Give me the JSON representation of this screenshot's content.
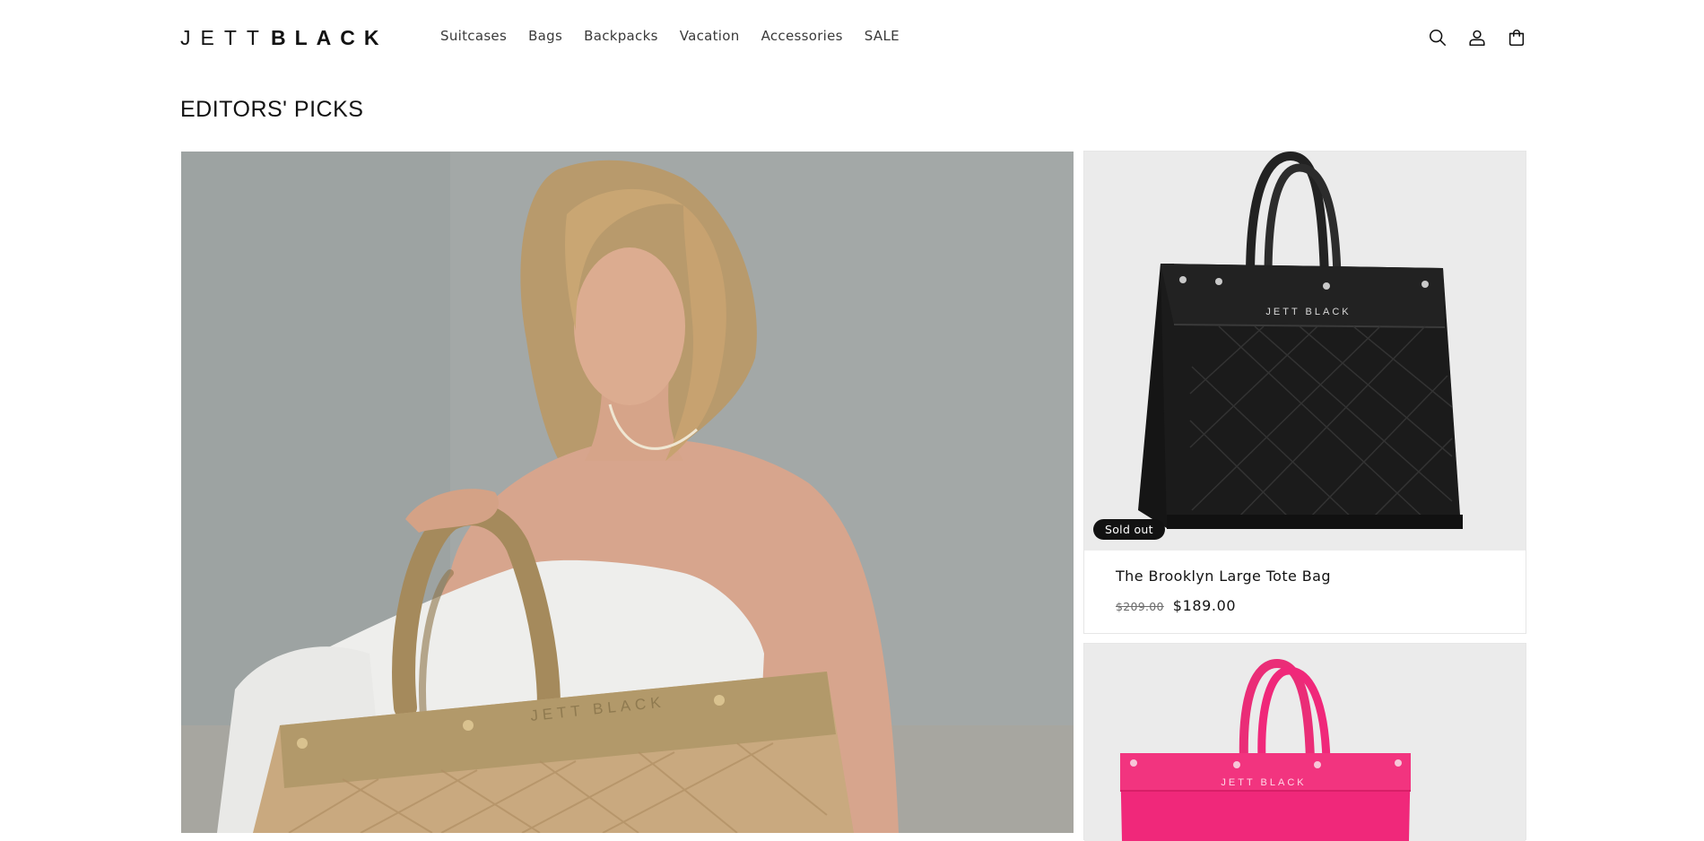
{
  "header": {
    "logo_light": "JETT",
    "logo_bold": "BLACK",
    "nav": [
      {
        "label": "Suitcases"
      },
      {
        "label": "Bags"
      },
      {
        "label": "Backpacks"
      },
      {
        "label": "Vacation"
      },
      {
        "label": "Accessories"
      },
      {
        "label": "SALE"
      }
    ],
    "icons": [
      "search-icon",
      "account-icon",
      "cart-icon"
    ]
  },
  "main": {
    "title": "EDITORS' PICKS",
    "hero": {
      "bag_brand_text": "JETT BLACK"
    },
    "products": [
      {
        "name": "The Brooklyn Large Tote Bag",
        "badge": "Sold out",
        "price_regular": "$209.00",
        "price_sale": "$189.00",
        "image_brand_text": "JETT BLACK",
        "image_color": "#1b1b1b"
      },
      {
        "name": "",
        "image_brand_text": "JETT BLACK",
        "image_color": "#f0287a"
      }
    ]
  },
  "colors": {
    "text": "#121212",
    "badge_bg": "#121212",
    "media_bg": "#ebebeb"
  }
}
